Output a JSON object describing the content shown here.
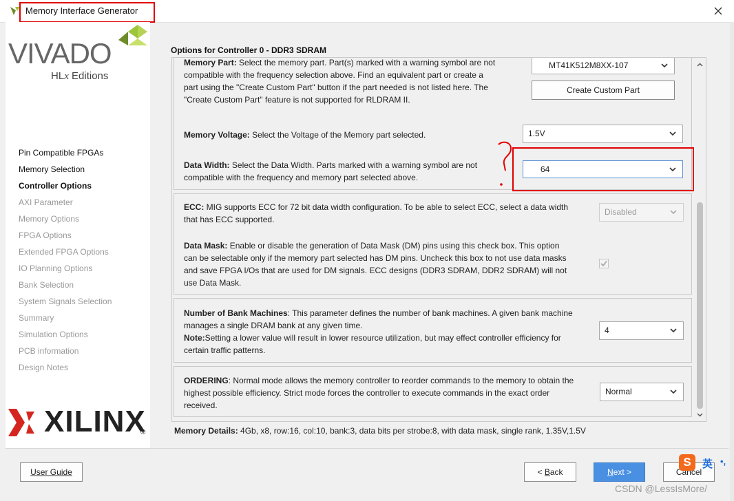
{
  "window": {
    "title": "Memory Interface Generator"
  },
  "brand": {
    "logo_word": "VIVADO",
    "edition_prefix": "HL",
    "edition_x": "x",
    "edition_suffix": " Editions",
    "vendor": "XILINX"
  },
  "sidebar": {
    "items": [
      {
        "label": "Pin Compatible FPGAs",
        "state": "past"
      },
      {
        "label": "Memory Selection",
        "state": "past"
      },
      {
        "label": "Controller Options",
        "state": "current"
      },
      {
        "label": "AXI Parameter",
        "state": "future"
      },
      {
        "label": "Memory Options",
        "state": "future"
      },
      {
        "label": "FPGA Options",
        "state": "future"
      },
      {
        "label": "Extended FPGA Options",
        "state": "future"
      },
      {
        "label": "IO Planning Options",
        "state": "future"
      },
      {
        "label": "Bank Selection",
        "state": "future"
      },
      {
        "label": "System Signals Selection",
        "state": "future"
      },
      {
        "label": "Summary",
        "state": "future"
      },
      {
        "label": "Simulation Options",
        "state": "future"
      },
      {
        "label": "PCB information",
        "state": "future"
      },
      {
        "label": "Design Notes",
        "state": "future"
      }
    ]
  },
  "main": {
    "heading": "Options for Controller 0 - DDR3 SDRAM",
    "memory_part": {
      "label": "Memory Part:",
      "desc_l1": " Select the memory part. Part(s) marked with a warning symbol are not",
      "desc_l2": "compatible with the frequency selection above. Find an equivalent part or create a",
      "desc_l3": "part using the \"Create Custom Part\" button if the part needed is not listed here. The",
      "desc_l4": "\"Create Custom Part\" feature is not supported for RLDRAM II.",
      "value": "MT41K512M8XX-107",
      "button": "Create Custom Part"
    },
    "memory_voltage": {
      "label": "Memory Voltage:",
      "desc": " Select the Voltage of the Memory part selected.",
      "value": "1.5V"
    },
    "data_width": {
      "label": "Data Width:",
      "desc_l1": " Select the Data Width. Parts marked with a warning symbol are not",
      "desc_l2": "compatible with the frequency and memory part selected above.",
      "value": "64"
    },
    "ecc": {
      "label": "ECC:",
      "desc_l1": " MIG supports ECC for 72 bit data width configuration. To be able to select ECC, select a data width",
      "desc_l2": "that has ECC supported.",
      "value": "Disabled"
    },
    "data_mask": {
      "label": "Data Mask:",
      "desc_l1": " Enable or disable the generation of Data Mask (DM) pins using this check box. This option",
      "desc_l2": "can be selectable only if the memory part selected has DM pins. Uncheck this box to not use data masks",
      "desc_l3": "and save FPGA I/Os that are used for DM signals. ECC designs (DDR3 SDRAM, DDR2 SDRAM) will not",
      "desc_l4": "use Data Mask.",
      "checked": true
    },
    "bank_machines": {
      "label": "Number of Bank Machines",
      "desc_l1": ": This parameter defines the number of bank machines. A given bank machine",
      "desc_l2": "manages a single DRAM bank at any given time.",
      "note_label": "Note:",
      "note_l1": "Setting a lower value will result in lower resource utilization, but may effect controller efficiency for",
      "note_l2": "certain traffic patterns.",
      "value": "4"
    },
    "ordering": {
      "label": "ORDERING",
      "desc_l1": ": Normal mode allows the memory controller to reorder commands to the memory to obtain the",
      "desc_l2": "highest possible efficiency. Strict mode forces the controller to execute commands in the exact order",
      "desc_l3": "received.",
      "value": "Normal"
    },
    "details": {
      "label": "Memory Details:",
      "value": " 4Gb, x8, row:16, col:10, bank:3, data bits per strobe:8, with data mask, single rank, 1.35V,1.5V"
    }
  },
  "footer": {
    "user_guide": "User Guide",
    "back_prefix": "< ",
    "back_key": "B",
    "back_rest": "ack",
    "next_key": "N",
    "next_rest": "ext >",
    "cancel": "Cancel"
  },
  "overlay": {
    "ime_logo": "S",
    "ime_text": "英",
    "ime_punct": "•,",
    "watermark": "CSDN @LessIsMore/"
  },
  "colors": {
    "accent_red": "#e10000",
    "next_button": "#4a90e2",
    "xilinx_red": "#d4261f",
    "vivado_green": "#9cc53a"
  }
}
